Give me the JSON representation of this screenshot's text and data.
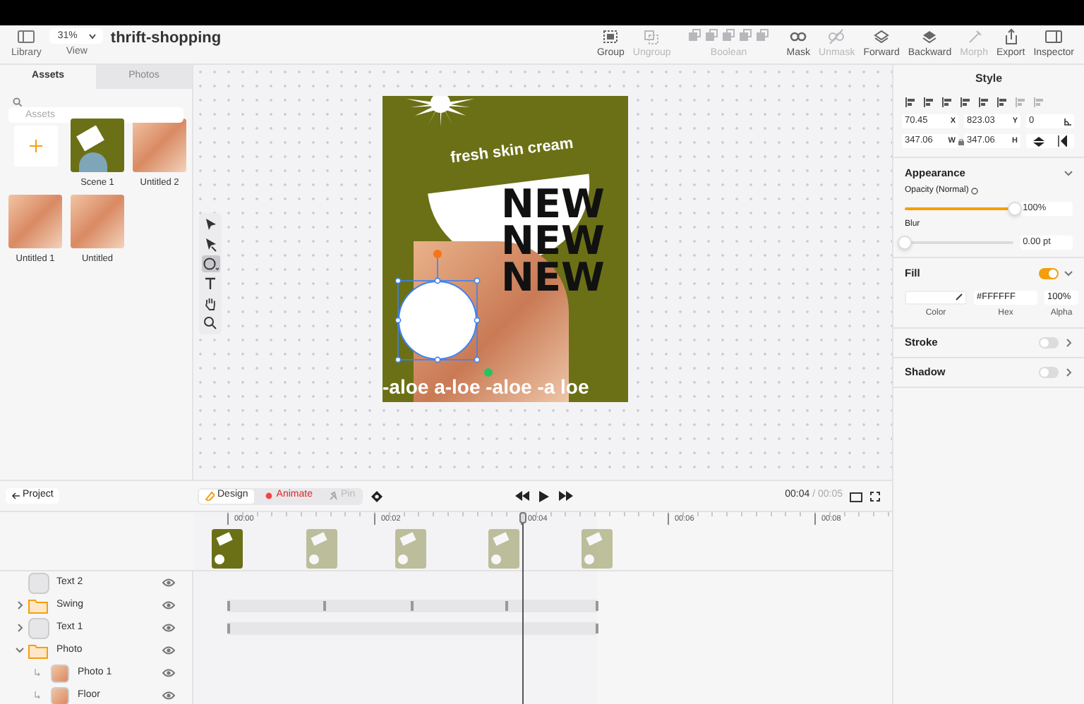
{
  "window": {
    "title": "thrift-shopping"
  },
  "toolbar": {
    "left": [
      {
        "kind": "library",
        "label": "Library"
      },
      {
        "kind": "view",
        "label": "View",
        "value": "31%"
      }
    ],
    "right": [
      {
        "kind": "group",
        "label": "Group",
        "disabled": false
      },
      {
        "kind": "ungroup",
        "label": "Ungroup",
        "disabled": true
      },
      {
        "kind": "boolean",
        "label": "Boolean",
        "disabled": true
      },
      {
        "kind": "mask",
        "label": "Mask",
        "disabled": false
      },
      {
        "kind": "unmask",
        "label": "Unmask",
        "disabled": true
      },
      {
        "kind": "forward",
        "label": "Forward",
        "disabled": false
      },
      {
        "kind": "backward",
        "label": "Backward",
        "disabled": false
      },
      {
        "kind": "morph",
        "label": "Morph",
        "disabled": true
      },
      {
        "kind": "export",
        "label": "Export",
        "disabled": false
      },
      {
        "kind": "inspector",
        "label": "Inspector",
        "disabled": false
      }
    ]
  },
  "assets_panel": {
    "tabs": [
      {
        "label": "Assets",
        "selected": true
      },
      {
        "label": "Photos",
        "selected": false
      }
    ],
    "search": {
      "placeholder": "Assets"
    },
    "items": [
      {
        "kind": "add"
      },
      {
        "kind": "scene",
        "label": "Scene 1"
      },
      {
        "kind": "photo",
        "label": "Untitled 2"
      },
      {
        "kind": "photo",
        "label": "Untitled 1"
      },
      {
        "kind": "photo",
        "label": "Untitled"
      }
    ]
  },
  "tools": [
    {
      "kind": "select",
      "selected": false
    },
    {
      "kind": "direct",
      "selected": false
    },
    {
      "kind": "shape",
      "selected": true
    },
    {
      "kind": "text",
      "selected": false
    },
    {
      "kind": "hand",
      "selected": false
    },
    {
      "kind": "zoom",
      "selected": false
    }
  ],
  "artboard": {
    "tagline": "fresh skin cream",
    "headline": [
      "NEW",
      "NEW",
      "NEW"
    ],
    "footer": "-aloe a-loe -aloe -a loe"
  },
  "inspector": {
    "title": "Style",
    "geometry": [
      {
        "kind": "unit",
        "value": "70.45",
        "unit": "X"
      },
      {
        "kind": "unit",
        "value": "823.03",
        "unit": "Y"
      },
      {
        "kind": "angle",
        "value": "0"
      },
      {
        "kind": "unit",
        "value": "347.06",
        "unit": "W"
      },
      {
        "kind": "lock"
      },
      {
        "kind": "unit",
        "value": "347.06",
        "unit": "H"
      },
      {
        "kind": "flip"
      }
    ],
    "appearance": {
      "title": "Appearance",
      "expanded": true,
      "opacity": {
        "label": "Opacity (Normal)",
        "level": 1,
        "value": "100%"
      },
      "blur": {
        "label": "Blur",
        "level": 0,
        "value": "0.00 pt"
      }
    },
    "fill": {
      "title": "Fill",
      "on": true,
      "expanded": true,
      "hex": "#FFFFFF",
      "alpha": "100%",
      "labels": [
        "Color",
        "Hex",
        "Alpha"
      ]
    },
    "stroke": {
      "title": "Stroke",
      "on": false
    },
    "shadow": {
      "title": "Shadow",
      "on": false
    }
  },
  "timeline": {
    "back_button": "Project",
    "modes": [
      {
        "kind": "design",
        "label": "Design",
        "selected": true,
        "disabled": false
      },
      {
        "kind": "animate",
        "label": "Animate",
        "selected": false,
        "disabled": false
      },
      {
        "kind": "pin",
        "label": "Pin",
        "selected": false,
        "disabled": true
      }
    ],
    "current_time": "00:04",
    "duration": "/ 00:05",
    "ruler": [
      "00:00",
      "00:02",
      "00:04",
      "00:06",
      "00:08"
    ],
    "keyframes": [
      {
        "selected": true
      },
      {
        "selected": false
      },
      {
        "selected": false
      },
      {
        "selected": false
      },
      {
        "selected": false
      }
    ],
    "layers": [
      {
        "name": "Text 2",
        "kind": "text"
      },
      {
        "name": "Swing",
        "kind": "folder",
        "expanded": false
      },
      {
        "name": "Text 1",
        "kind": "shape",
        "expanded": false
      },
      {
        "name": "Photo",
        "kind": "folder",
        "expanded": true,
        "children": [
          {
            "name": "Photo 1",
            "kind": "photo"
          },
          {
            "name": "Floor",
            "kind": "photo"
          }
        ]
      }
    ]
  }
}
